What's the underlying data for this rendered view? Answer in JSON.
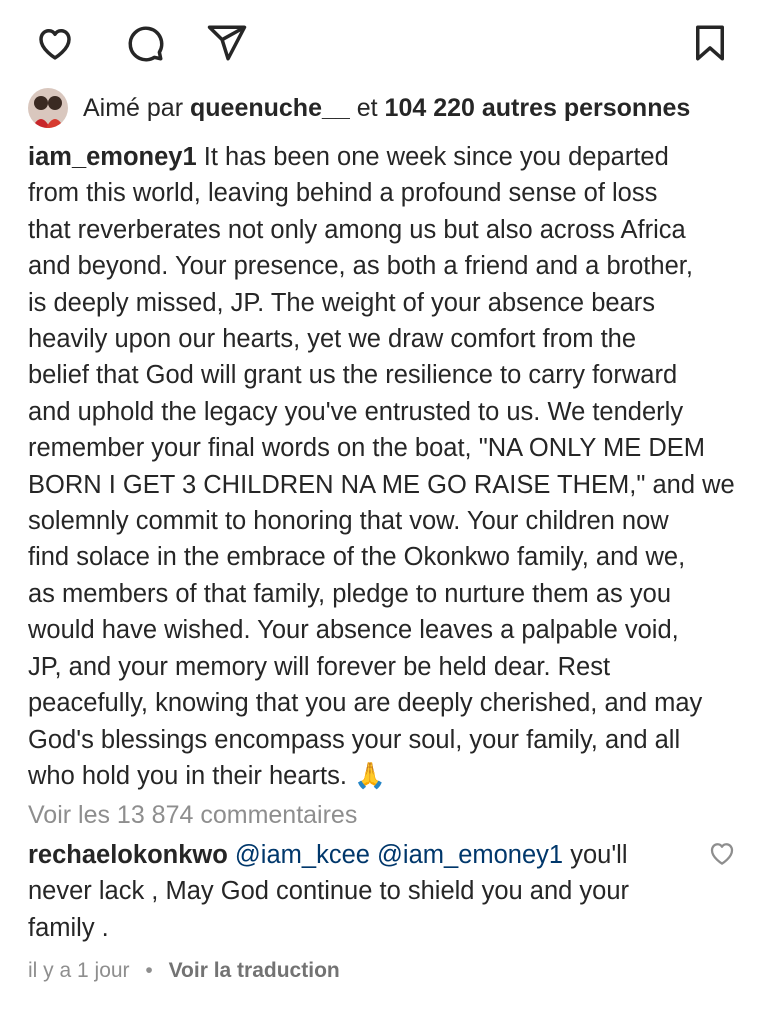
{
  "actions": {
    "like": "heart-icon",
    "comment": "comment-icon",
    "share": "share-icon",
    "save": "bookmark-icon"
  },
  "likes": {
    "prefix": "Aimé par",
    "user": "queenuche__",
    "middle": "et",
    "count": "104 220 autres personnes"
  },
  "post": {
    "username": "iam_emoney1",
    "caption": "It has been one week since you departed\nfrom this world, leaving behind a profound sense of loss\nthat reverberates not only among us but also across Africa\nand beyond. Your presence, as both a friend and a brother,\nis deeply missed, JP. The weight of your absence bears\nheavily upon our hearts, yet we draw comfort from the\nbelief that God will grant us the resilience to carry forward\nand uphold the legacy you've entrusted to us. We tenderly\nremember your final words on the boat, \"NA ONLY ME DEM\nBORN I GET 3 CHILDREN NA ME GO RAISE THEM,\" and we\nsolemnly commit to honoring that vow. Your children now\nfind solace in the embrace of the Okonkwo family, and we,\nas members of that family, pledge to nurture them as you\nwould have wished. Your absence leaves a palpable void,\nJP, and your memory will forever be held dear. Rest\npeacefully, knowing that you are deeply cherished, and may\nGod's blessings encompass your soul, your family, and all\nwho hold you in their hearts. 🙏"
  },
  "view_comments": "Voir les 13 874 commentaires",
  "comment": {
    "username": "rechaelokonkwo",
    "mention1": "@iam_kcee",
    "mention2": "@iam_emoney1",
    "text_first": "you'll",
    "text_rest": "never lack , May God continue to shield you and your\nfamily ."
  },
  "meta": {
    "time": "il y a 1 jour",
    "separator": "•",
    "translate": "Voir la traduction"
  }
}
